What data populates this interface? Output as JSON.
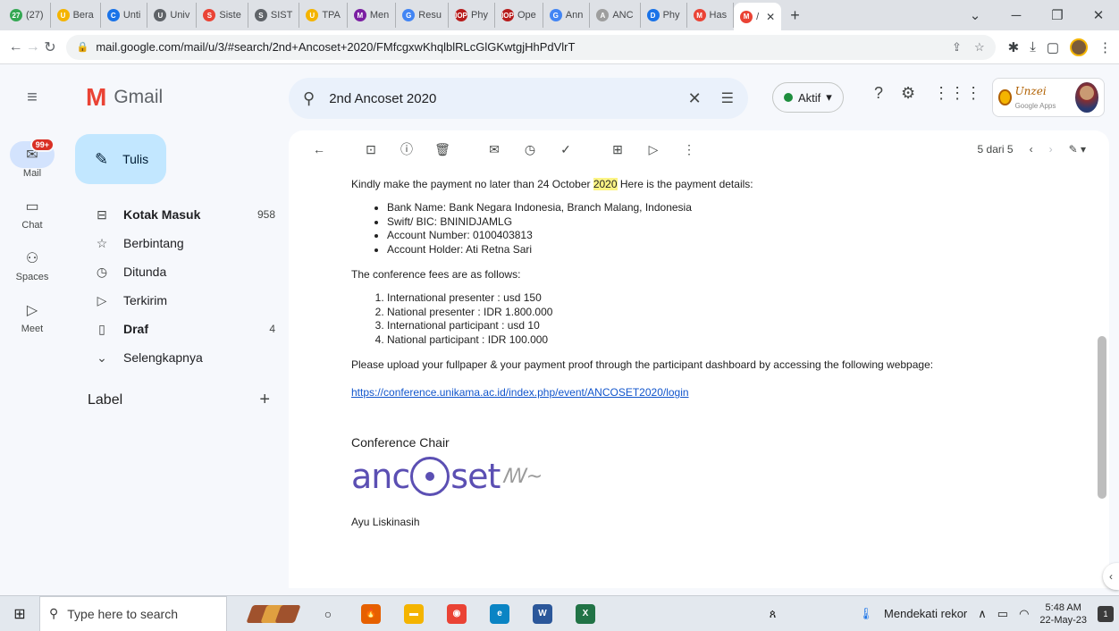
{
  "browser": {
    "tabs": [
      {
        "label": "(27)",
        "color": "#34a853",
        "glyph": "27"
      },
      {
        "label": "Bera",
        "color": "#f4b400",
        "glyph": "U"
      },
      {
        "label": "Unti",
        "color": "#1a73e8",
        "glyph": "C"
      },
      {
        "label": "Univ",
        "color": "#5f6368",
        "glyph": "U"
      },
      {
        "label": "Siste",
        "color": "#ea4335",
        "glyph": "S"
      },
      {
        "label": "SIST",
        "color": "#5f6368",
        "glyph": "S"
      },
      {
        "label": "TPA",
        "color": "#f4b400",
        "glyph": "U"
      },
      {
        "label": "Men",
        "color": "#7b1fa2",
        "glyph": "M"
      },
      {
        "label": "Resu",
        "color": "#4285f4",
        "glyph": "G"
      },
      {
        "label": "Phy",
        "color": "#b71c1c",
        "glyph": "IOP"
      },
      {
        "label": "Ope",
        "color": "#b71c1c",
        "glyph": "IOP"
      },
      {
        "label": "Ann",
        "color": "#4285f4",
        "glyph": "G"
      },
      {
        "label": "ANC",
        "color": "#9e9e9e",
        "glyph": "A"
      },
      {
        "label": "Phy",
        "color": "#1a73e8",
        "glyph": "D"
      },
      {
        "label": "Has",
        "color": "#ea4335",
        "glyph": "M"
      }
    ],
    "active_tab": {
      "label": "/",
      "glyph": "M",
      "color": "#ea4335"
    },
    "url": "mail.google.com/mail/u/3/#search/2nd+Ancoset+2020/FMfcgxwKhqlblRLcGlGKwtgjHhPdVlrT"
  },
  "gmail": {
    "logo_text": "Gmail",
    "search_value": "2nd Ancoset 2020",
    "status": "Aktif",
    "org_name": "Unzei",
    "org_sub": "Google Apps",
    "rail": [
      {
        "label": "Mail",
        "icon": "mail-icon",
        "badge": "99+"
      },
      {
        "label": "Chat",
        "icon": "chat-icon"
      },
      {
        "label": "Spaces",
        "icon": "spaces-icon"
      },
      {
        "label": "Meet",
        "icon": "meet-icon"
      }
    ],
    "compose_label": "Tulis",
    "nav": [
      {
        "label": "Kotak Masuk",
        "count": "958",
        "icon": "inbox-icon",
        "bold": true
      },
      {
        "label": "Berbintang",
        "count": "",
        "icon": "star-icon",
        "bold": false
      },
      {
        "label": "Ditunda",
        "count": "",
        "icon": "clock-icon",
        "bold": false
      },
      {
        "label": "Terkirim",
        "count": "",
        "icon": "send-icon",
        "bold": false
      },
      {
        "label": "Draf",
        "count": "4",
        "icon": "draft-icon",
        "bold": true
      },
      {
        "label": "Selengkapnya",
        "count": "",
        "icon": "chevron-down-icon",
        "bold": false
      }
    ],
    "labels_heading": "Label",
    "pager_text": "5 dari 5"
  },
  "email": {
    "intro_before": "Kindly make the payment no later than 24 October ",
    "intro_hl": "2020",
    "intro_after": " Here is the payment details:",
    "payment": [
      "Bank Name: Bank Negara Indonesia, Branch Malang, Indonesia",
      "Swift/ BIC: BNINIDJAMLG",
      "Account Number: 0100403813",
      "Account Holder: Ati Retna Sari"
    ],
    "fees_intro": "The conference fees are as follows:",
    "fees": [
      "International presenter : usd 150",
      "National presenter : IDR 1.800.000",
      "International participant : usd 10",
      "National participant : IDR 100.000"
    ],
    "upload_text": "Please upload your fullpaper & your payment proof through the participant dashboard by accessing the following webpage:",
    "link": "https://conference.unikama.ac.id/index.php/event/ANCOSET2020/login",
    "closing": "Conference Chair",
    "logo_left": "anc",
    "logo_right": "set",
    "signer": "Ayu Liskinasih"
  },
  "taskbar": {
    "search_placeholder": "Type here to search",
    "weather": "Mendekati rekor",
    "time": "5:48 AM",
    "date": "22-May-23",
    "notif_count": "1"
  }
}
